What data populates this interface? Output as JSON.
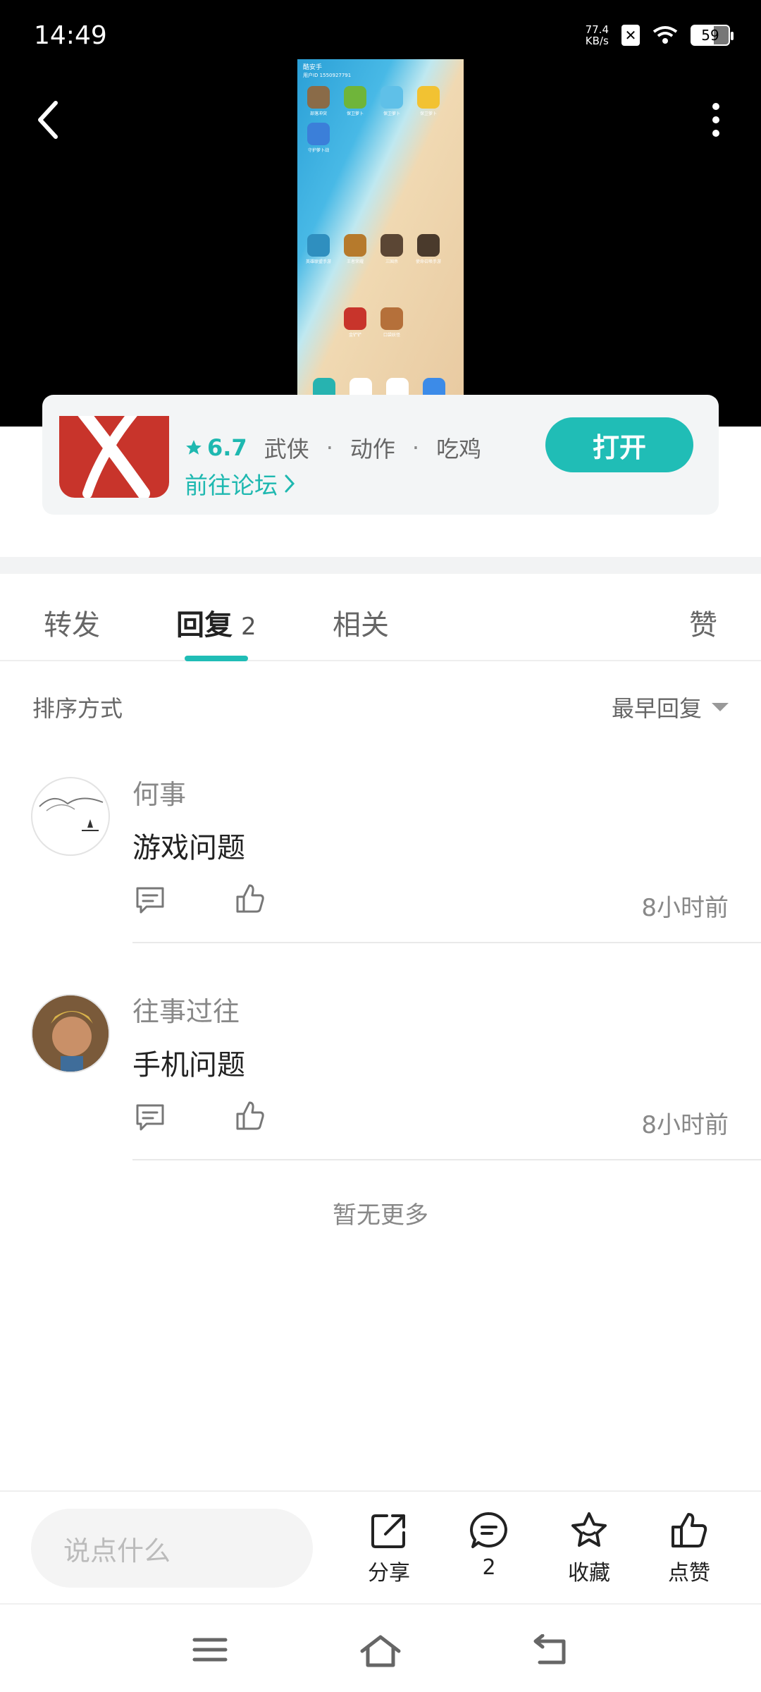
{
  "status_bar": {
    "time": "14:49",
    "net_speed_value": "77.4",
    "net_speed_unit": "KB/s",
    "battery": "59"
  },
  "preview": {
    "status_text": "酷安手",
    "sub_text": "用户ID 1550927791",
    "app_labels": [
      "部落冲突",
      "保卫萝卜",
      "保卫萝卜",
      "保卫萝卜",
      "守护萝卜战",
      "英雄联盟手游",
      "王者荣耀",
      "三国杀",
      "使命召唤手游",
      "金铲铲",
      "口袋妖怪"
    ]
  },
  "game_card": {
    "rating": "6.7",
    "tags": [
      "武侠",
      "动作",
      "吃鸡"
    ],
    "forum_link": "前往论坛",
    "open_button": "打开"
  },
  "tabs": {
    "forward": "转发",
    "reply": "回复",
    "reply_count": "2",
    "related": "相关",
    "like": "赞"
  },
  "sort": {
    "label": "排序方式",
    "value": "最早回复"
  },
  "replies": [
    {
      "name": "何事",
      "text": "游戏问题",
      "time": "8小时前"
    },
    {
      "name": "往事过往",
      "text": "手机问题",
      "time": "8小时前"
    }
  ],
  "no_more": "暂无更多",
  "bottom_bar": {
    "input_placeholder": "说点什么",
    "share": "分享",
    "comment_count": "2",
    "favorite": "收藏",
    "like": "点赞"
  },
  "colors": {
    "accent": "#20bdb6",
    "logo_red": "#c8342b"
  }
}
